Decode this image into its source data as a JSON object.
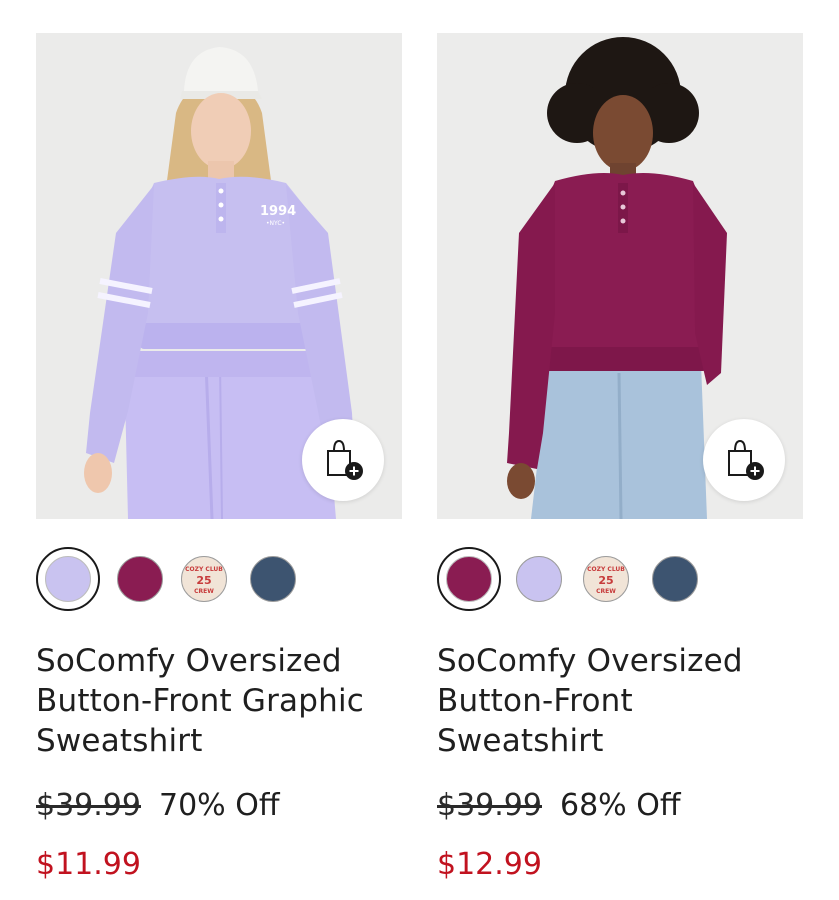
{
  "products": [
    {
      "title": "SoComfy Oversized Button-Front Graphic Sweatshirt",
      "original_price": "$39.99",
      "discount": "70% Off",
      "sale_price": "$11.99",
      "graphic_text": "1994",
      "graphic_subtext": "•NYC•",
      "swatches": [
        {
          "name": "lavender",
          "color": "#c9c3f0",
          "selected": true
        },
        {
          "name": "plum",
          "color": "#8a1c52",
          "selected": false
        },
        {
          "name": "cozy-club-25-crew",
          "color": "#f1e4d7",
          "selected": false,
          "pattern": [
            "COZY CLUB",
            "25",
            "CREW"
          ]
        },
        {
          "name": "navy",
          "color": "#3d5470",
          "selected": false
        }
      ]
    },
    {
      "title": "SoComfy Oversized Button-Front Sweatshirt",
      "original_price": "$39.99",
      "discount": "68% Off",
      "sale_price": "$12.99",
      "swatches": [
        {
          "name": "plum",
          "color": "#8a1c52",
          "selected": true
        },
        {
          "name": "lavender",
          "color": "#c9c3f0",
          "selected": false
        },
        {
          "name": "cozy-club-25-crew",
          "color": "#f1e4d7",
          "selected": false,
          "pattern": [
            "COZY CLUB",
            "25",
            "CREW"
          ]
        },
        {
          "name": "navy",
          "color": "#3d5470",
          "selected": false
        }
      ]
    }
  ],
  "icons": {
    "add_to_bag": "shopping-bag-plus-icon"
  },
  "colors": {
    "sale": "#c1121f",
    "lavender": "#c6bff0",
    "plum": "#8a1c52",
    "denim": "#a9c2db"
  }
}
